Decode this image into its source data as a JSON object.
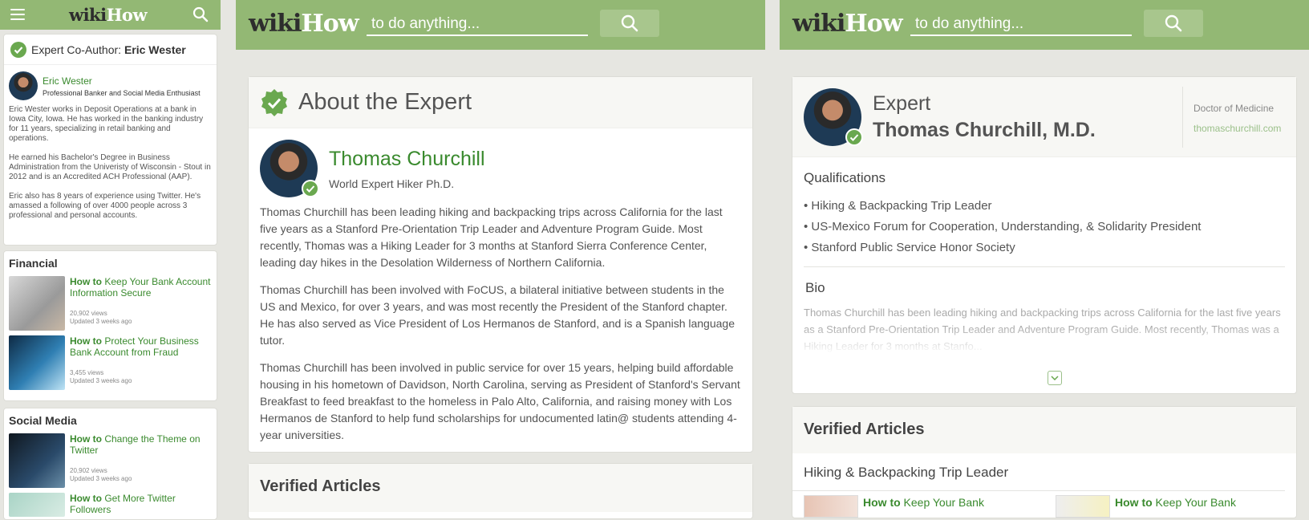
{
  "colors": {
    "brand_green": "#93b874",
    "link_green": "#3a8a2e",
    "check_green": "#6aa84f"
  },
  "mobile": {
    "logo_wiki": "wiki",
    "logo_how": "How",
    "coauthor_prefix": "Expert Co-Author: ",
    "coauthor_name": "Eric Wester",
    "person_name": "Eric Wester",
    "person_title": "Professional Banker and Social Media Enthusiast",
    "bio": [
      "Eric Wester works in Deposit Operations at a bank in Iowa City, Iowa. He has worked in the banking industry for 11 years, specializing in retail banking and operations.",
      "He earned his Bachelor's Degree in Business Administration from the Univeristy of Wisconsin - Stout in 2012 and is an Accredited ACH Professional (AAP).",
      "Eric also has 8 years of experience using Twitter. He's amassed a following of over 4000 people across 3 professional and personal accounts."
    ],
    "sections": [
      {
        "title": "Financial",
        "articles": [
          {
            "how": "How to",
            "title": "Keep Your Bank Account Information Secure",
            "views": "20,902 views",
            "updated": "Updated 3 weeks ago"
          },
          {
            "how": "How to",
            "title": "Protect Your Business Bank Account from Fraud",
            "views": "3,455 views",
            "updated": "Updated 3 weeks ago"
          }
        ]
      },
      {
        "title": "Social Media",
        "articles": [
          {
            "how": "How to",
            "title": "Change the Theme on Twitter",
            "views": "20,902 views",
            "updated": "Updated 3 weeks ago"
          },
          {
            "how": "How to",
            "title": "Get More Twitter Followers",
            "views": "",
            "updated": ""
          }
        ]
      }
    ]
  },
  "desktop1": {
    "logo_wiki": "wiki",
    "logo_how": "How",
    "search_placeholder": "to do anything...",
    "about_heading": "About the Expert",
    "expert_name": "Thomas Churchill",
    "expert_sub": "World Expert Hiker Ph.D.",
    "bio": [
      "Thomas Churchill has been leading hiking and backpacking trips across California for the last five years as a Stanford Pre-Orientation Trip Leader and Adventure Program Guide. Most recently, Thomas was a Hiking Leader for 3 months at Stanford Sierra Conference Center, leading day hikes in the Desolation Wilderness of Northern California.",
      "Thomas Churchill has been involved with FoCUS, a bilateral initiative between students in the US and Mexico, for over 3 years, and was most recently the President of the Stanford chapter. He has also served as Vice President of Los Hermanos de Stanford, and is a Spanish language tutor.",
      "Thomas Churchill has been involved in public service for over 15 years, helping build affordable housing in his hometown of Davidson, North Carolina, serving as President of Stanford's Servant Breakfast to feed breakfast to the homeless in Palo Alto, California, and raising money with Los Hermanos de Stanford to help fund scholarships for undocumented latin@ students attending 4-year universities."
    ],
    "verified_heading": "Verified Articles"
  },
  "desktop2": {
    "logo_wiki": "wiki",
    "logo_how": "How",
    "search_placeholder": "to do anything...",
    "expert_label": "Expert",
    "expert_name": "Thomas Churchill, M.D.",
    "degree": "Doctor of Medicine",
    "website": "thomaschurchill.com",
    "qualifications_heading": "Qualifications",
    "qualifications": [
      "• Hiking & Backpacking Trip Leader",
      "• US-Mexico Forum for Cooperation, Understanding, & Solidarity President",
      "• Stanford Public Service Honor Society"
    ],
    "bio_heading": "Bio",
    "bio_text": "Thomas Churchill has been leading hiking and backpacking trips across California for the last five years as a Stanford Pre-Orientation Trip Leader and Adventure Program Guide. Most recently, Thomas was a Hiking Leader for 3 months at Stanfo...",
    "verified_heading": "Verified Articles",
    "verified_sub": "Hiking & Backpacking Trip Leader",
    "articles": [
      {
        "how": "How to",
        "title": "Keep Your Bank"
      },
      {
        "how": "How to",
        "title": "Keep Your Bank"
      }
    ]
  }
}
